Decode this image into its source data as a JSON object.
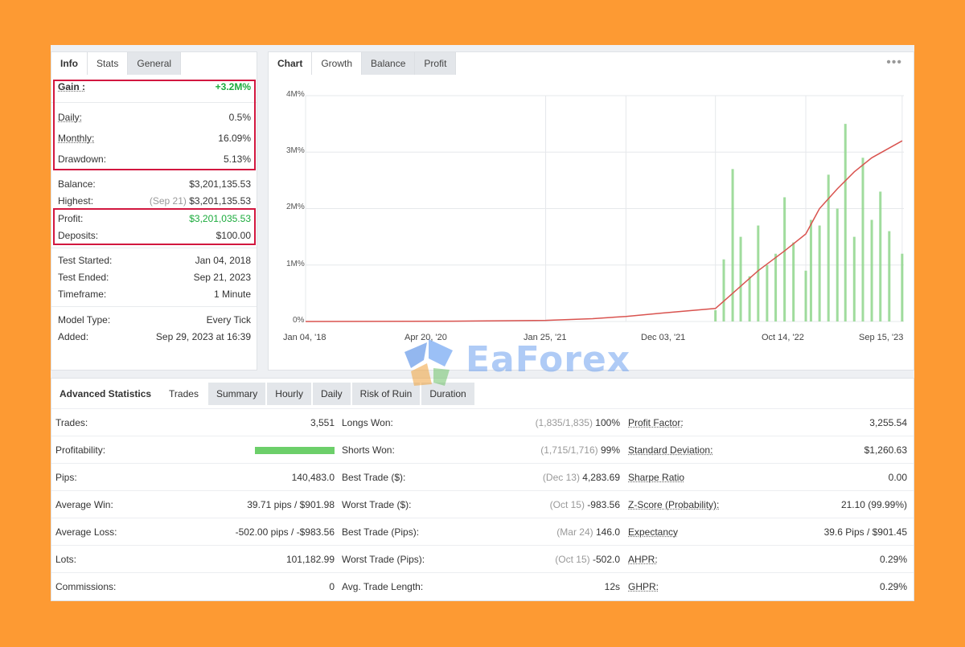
{
  "colors": {
    "background": "#fd9a33",
    "highlight_box": "#d2173f",
    "gain_green": "#1bab3c",
    "balance_line": "#d9534f",
    "trade_bars": "#8fd68c"
  },
  "info_panel": {
    "tabs": [
      "Info",
      "Stats",
      "General"
    ],
    "gain": {
      "label": "Gain :",
      "value": "+3.2M%"
    },
    "daily": {
      "label": "Daily:",
      "value": "0.5%"
    },
    "monthly": {
      "label": "Monthly:",
      "value": "16.09%"
    },
    "drawdown": {
      "label": "Drawdown:",
      "value": "5.13%"
    },
    "balance": {
      "label": "Balance:",
      "value": "$3,201,135.53"
    },
    "highest": {
      "label": "Highest:",
      "date": "(Sep 21)",
      "value": "$3,201,135.53"
    },
    "profit": {
      "label": "Profit:",
      "value": "$3,201,035.53"
    },
    "deposits": {
      "label": "Deposits:",
      "value": "$100.00"
    },
    "test_started": {
      "label": "Test Started:",
      "value": "Jan 04, 2018"
    },
    "test_ended": {
      "label": "Test Ended:",
      "value": "Sep 21, 2023"
    },
    "timeframe": {
      "label": "Timeframe:",
      "value": "1 Minute"
    },
    "model_type": {
      "label": "Model Type:",
      "value": "Every Tick"
    },
    "added": {
      "label": "Added:",
      "value": "Sep 29, 2023 at 16:39"
    }
  },
  "chart_panel": {
    "tabs": [
      "Chart",
      "Growth",
      "Balance",
      "Profit"
    ],
    "menu_icon": "more-dots-icon"
  },
  "chart_data": {
    "type": "line",
    "y_ticks": [
      "4M%",
      "3M%",
      "2M%",
      "1M%",
      "0%"
    ],
    "x_ticks": [
      "Jan 04, '18",
      "Apr 20, '20",
      "Jan 25, '21",
      "Dec 03, '21",
      "Oct 14, '22",
      "Sep 15, '23"
    ],
    "ylim": [
      0,
      4000000
    ],
    "grid": true,
    "series": [
      {
        "kind": "line",
        "x": [
          "2018-01-04",
          "2019-06-01",
          "2020-04-20",
          "2020-10-01",
          "2021-01-25",
          "2021-06-01",
          "2021-12-03",
          "2022-02-01",
          "2022-05-01",
          "2022-08-01",
          "2022-10-14",
          "2022-12-01",
          "2023-02-01",
          "2023-04-01",
          "2023-06-01",
          "2023-09-15"
        ],
        "values": [
          0,
          5000,
          20000,
          50000,
          90000,
          150000,
          230000,
          500000,
          900000,
          1250000,
          1550000,
          2000000,
          2350000,
          2650000,
          2900000,
          3200000
        ]
      },
      {
        "kind": "bar",
        "x": [
          "2021-12-03",
          "2022-01-01",
          "2022-02-01",
          "2022-03-01",
          "2022-04-01",
          "2022-05-01",
          "2022-06-01",
          "2022-07-01",
          "2022-08-01",
          "2022-09-01",
          "2022-10-14",
          "2022-11-01",
          "2022-12-01",
          "2023-01-01",
          "2023-02-01",
          "2023-03-01",
          "2023-04-01",
          "2023-05-01",
          "2023-06-01",
          "2023-07-01",
          "2023-08-01",
          "2023-09-15"
        ],
        "values": [
          200000,
          1100000,
          2700000,
          1500000,
          800000,
          1700000,
          1000000,
          1200000,
          2200000,
          1400000,
          900000,
          1800000,
          1700000,
          2600000,
          2000000,
          3500000,
          1500000,
          2900000,
          1800000,
          2300000,
          1600000,
          1200000
        ]
      }
    ]
  },
  "watermark": {
    "text": "EaForex"
  },
  "advanced": {
    "tabs": [
      "Advanced Statistics",
      "Trades",
      "Summary",
      "Hourly",
      "Daily",
      "Risk of Ruin",
      "Duration"
    ],
    "rows": [
      {
        "l1": "Trades:",
        "v1": "3,551",
        "l2": "Longs Won:",
        "m2": "(1,835/1,835)",
        "v2": "100%",
        "l3": "Profit Factor:",
        "v3": "3,255.54"
      },
      {
        "l1": "Profitability:",
        "v1": "",
        "l2": "Shorts Won:",
        "m2": "(1,715/1,716)",
        "v2": "99%",
        "l3": "Standard Deviation:",
        "v3": "$1,260.63"
      },
      {
        "l1": "Pips:",
        "v1": "140,483.0",
        "l2": "Best Trade ($):",
        "m2": "(Dec 13)",
        "v2": "4,283.69",
        "l3": "Sharpe Ratio",
        "v3": "0.00"
      },
      {
        "l1": "Average Win:",
        "v1": "39.71 pips / $901.98",
        "l2": "Worst Trade ($):",
        "m2": "(Oct 15)",
        "v2": "-983.56",
        "l3": "Z-Score (Probability):",
        "v3": "21.10 (99.99%)"
      },
      {
        "l1": "Average Loss:",
        "v1": "-502.00 pips / -$983.56",
        "l2": "Best Trade (Pips):",
        "m2": "(Mar 24)",
        "v2": "146.0",
        "l3": "Expectancy",
        "v3": "39.6 Pips / $901.45"
      },
      {
        "l1": "Lots:",
        "v1": "101,182.99",
        "l2": "Worst Trade (Pips):",
        "m2": "(Oct 15)",
        "v2": "-502.0",
        "l3": "AHPR:",
        "v3": "0.29%"
      },
      {
        "l1": "Commissions:",
        "v1": "0",
        "l2": "Avg. Trade Length:",
        "m2": "",
        "v2": "12s",
        "l3": "GHPR:",
        "v3": "0.29%"
      }
    ],
    "profitability_fraction": 0.99
  }
}
